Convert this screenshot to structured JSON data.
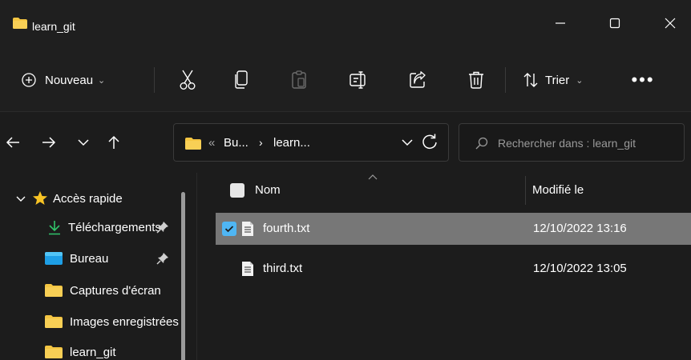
{
  "window": {
    "title": "learn_git"
  },
  "commandbar": {
    "new_label": "Nouveau",
    "sort_label": "Trier",
    "more_label": "•••"
  },
  "address": {
    "overflow": "«",
    "segments": [
      "Bu...",
      "learn..."
    ],
    "separator": "›"
  },
  "search": {
    "placeholder": "Rechercher dans : learn_git"
  },
  "sidebar": {
    "items": [
      {
        "label": "Accès rapide",
        "icon": "star-icon"
      },
      {
        "label": "Téléchargements",
        "icon": "download-icon",
        "pinned": true
      },
      {
        "label": "Bureau",
        "icon": "desktop-folder-icon",
        "pinned": true
      },
      {
        "label": "Captures d'écran",
        "icon": "folder-icon"
      },
      {
        "label": "Images enregistrées",
        "icon": "folder-icon"
      },
      {
        "label": "learn_git",
        "icon": "folder-icon"
      }
    ]
  },
  "list": {
    "columns": {
      "name": "Nom",
      "modified": "Modifié le"
    },
    "files": [
      {
        "name": "fourth.txt",
        "modified": "12/10/2022 13:16",
        "selected": true
      },
      {
        "name": "third.txt",
        "modified": "12/10/2022 13:05",
        "selected": false
      }
    ]
  },
  "colors": {
    "background": "#1c1c1c",
    "folder": "#f4c542",
    "accent": "#4fb6f4",
    "selection": "#777777"
  }
}
